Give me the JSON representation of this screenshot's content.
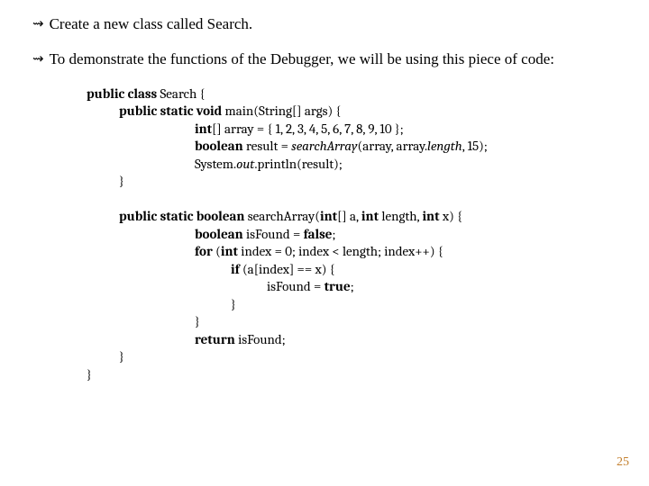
{
  "bullets": {
    "icon": "⇝",
    "item1": "Create a new class called Search.",
    "item2": "To demonstrate the functions of the Debugger, we will be using this piece of code:"
  },
  "code": {
    "l01a": "public class ",
    "l01b": "Search {",
    "l02a": "public static void ",
    "l02b": "main(String[] args) {",
    "l03a": "int",
    "l03b": "[] array = { 1, 2, 3, 4, 5, 6, 7, 8, 9, 10 };",
    "l04a": "boolean ",
    "l04b": "result = ",
    "l04c": "searchArray",
    "l04d": "(array, array.",
    "l04e": "length",
    "l04f": ", 15);",
    "l05a": "System.",
    "l05b": "out",
    "l05c": ".println(result);",
    "l06": "}",
    "l07a": "public static boolean ",
    "l07b": "searchArray(",
    "l07c": "int",
    "l07d": "[] a, ",
    "l07e": "int ",
    "l07f": "length, ",
    "l07g": "int ",
    "l07h": "x) {",
    "l08a": "boolean ",
    "l08b": "isFound = ",
    "l08c": "false",
    "l08d": ";",
    "l09a": "for ",
    "l09b": "(",
    "l09c": "int ",
    "l09d": "index = 0; index < length; index++) {",
    "l10a": "if ",
    "l10b": "(a[index] == x) {",
    "l11a": "isFound = ",
    "l11b": "true",
    "l11c": ";",
    "l12": "}",
    "l13": "}",
    "l14a": "return ",
    "l14b": "isFound;",
    "l15": "}",
    "l16": "}"
  },
  "pageNumber": "25"
}
